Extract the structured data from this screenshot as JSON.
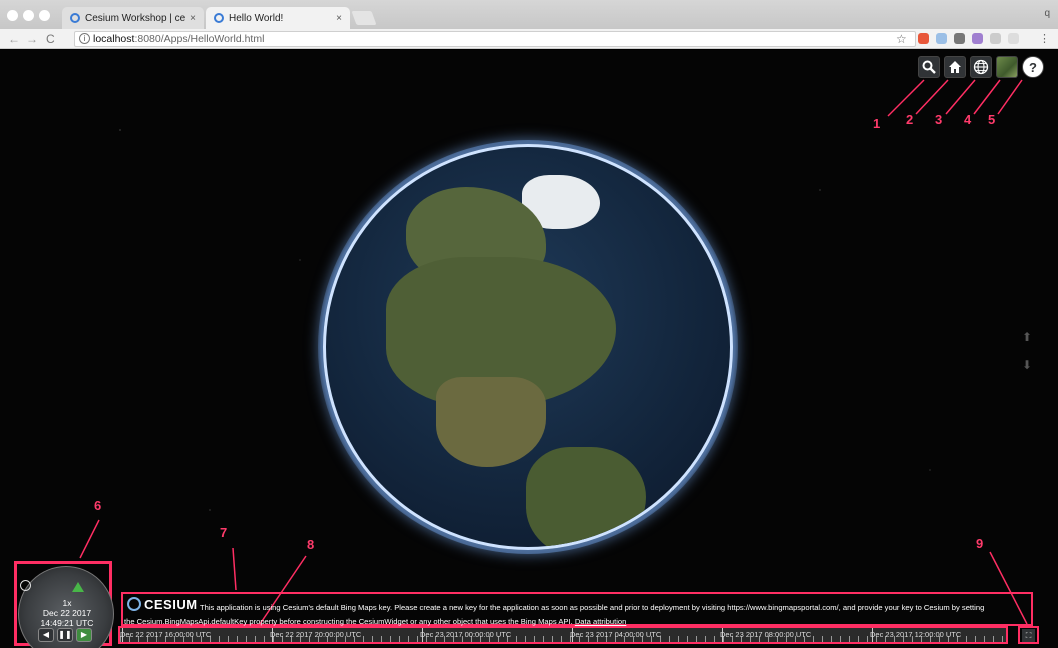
{
  "browser": {
    "tabs": [
      {
        "title": "Cesium Workshop | cesiumjs.c",
        "close": "×"
      },
      {
        "title": "Hello World!",
        "close": "×"
      }
    ],
    "url_host": "localhost",
    "url_path": ":8080/Apps/HelloWorld.html",
    "info_glyph": "i",
    "star": "☆",
    "corner": "q",
    "menu": "⋮",
    "back": "←",
    "forward": "→",
    "reload": "C"
  },
  "toolbar": {
    "icons": [
      "search-icon",
      "home-icon",
      "globe-icon",
      "imagery-layer-icon",
      "help-icon"
    ],
    "help_glyph": "?"
  },
  "annotations": [
    "1",
    "2",
    "3",
    "4",
    "5",
    "6",
    "7",
    "8",
    "9"
  ],
  "animation": {
    "speed": "1x",
    "date": "Dec 22 2017",
    "time": "14:49:21 UTC",
    "reverse": "◀",
    "pause": "❚❚",
    "play": "▶"
  },
  "credits": {
    "logo": "CESIUM",
    "line1": "This application is using Cesium's default Bing Maps key. Please create a new key for the application as soon as possible and prior to deployment by visiting https://www.bingmapsportal.com/, and provide your key to Cesium by setting",
    "line2": "the Cesium.BingMapsApi.defaultKey property before constructing the CesiumWidget or any other object that uses the Bing Maps API.",
    "link": "Data attribution"
  },
  "timeline": {
    "labels": [
      "Dec 22 2017 16:00:00 UTC",
      "Dec 22 2017 20:00:00 UTC",
      "Dec 23 2017 00:00:00 UTC",
      "Dec 23 2017 04:00:00 UTC",
      "Dec 23 2017 08:00:00 UTC",
      "Dec 23 2017 12:00:00 UTC"
    ]
  },
  "fullscreen_glyph": "⛶",
  "colors": {
    "annotation": "#ff2e63",
    "accent_green": "#48b648",
    "toolbar_bg": "#303336"
  }
}
